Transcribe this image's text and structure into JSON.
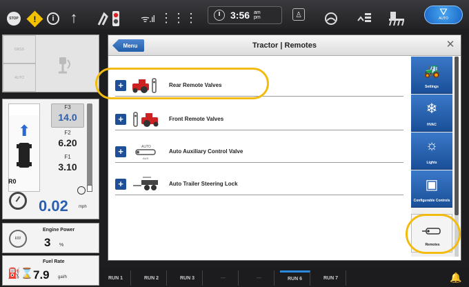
{
  "topbar": {
    "stop_text": "STOP",
    "warn_glyph": "!",
    "info_glyph": "i",
    "up_glyph": "↑",
    "signal_glyph": "ᯤ.ıl",
    "grid_glyph": "⋮⋮⋮",
    "time": "3:56",
    "ampm": "am\npm",
    "person_glyph": "♙",
    "auto_nav_glyph": "⛛",
    "auto_label": "AUTO",
    "icons": [
      "stop-icon",
      "warning-icon",
      "info-icon",
      "up-arrow-icon",
      "hitch-error-icon",
      "signal-icon",
      "grid-icon",
      "clock-icon",
      "person-icon",
      "steering-icon",
      "lift-icon",
      "implement-icon",
      "auto-steer-icon"
    ]
  },
  "left": {
    "top_labels": [
      "GNSS",
      "AUTO"
    ],
    "gears": [
      {
        "name": "F3",
        "value": "14.0"
      },
      {
        "name": "F2",
        "value": "6.20"
      },
      {
        "name": "F1",
        "value": "3.10"
      }
    ],
    "range": "R0",
    "speed": "0.02",
    "speed_unit": "mph",
    "engine_power_label": "Engine Power",
    "engine_power_value": "3",
    "engine_power_unit": "%",
    "engine_icon_text": "kW",
    "fuel_rate_label": "Fuel Rate",
    "fuel_rate_value": "7.9",
    "fuel_rate_unit": "gal/h"
  },
  "dialog": {
    "menu_label": "Menu",
    "title": "Tractor | Remotes",
    "close_glyph": "✕",
    "rows": [
      {
        "label": "Rear Remote Valves",
        "icon": "rear-remote-icon"
      },
      {
        "label": "Front Remote Valves",
        "icon": "front-remote-icon"
      },
      {
        "label": "Auto Auxiliary Control Valve",
        "icon": "auto-aux-valve-icon",
        "icon_text_top": "AUTO",
        "icon_text_bottom": "AUX"
      },
      {
        "label": "Auto Trailer Steering Lock",
        "icon": "trailer-steering-icon"
      }
    ]
  },
  "sidebar": {
    "buttons": [
      {
        "label": "Settings",
        "icon": "tractor-settings-icon"
      },
      {
        "label": "HVAC",
        "icon": "hvac-icon"
      },
      {
        "label": "Lights",
        "icon": "lights-icon"
      },
      {
        "label": "Configurable Controls",
        "icon": "configurable-controls-icon"
      },
      {
        "label": "Remotes",
        "icon": "remotes-icon"
      }
    ]
  },
  "runbar": {
    "slots": [
      "RUN 1",
      "RUN 2",
      "RUN 3",
      "—",
      "—",
      "RUN 6",
      "RUN 7"
    ],
    "bell_glyph": "🔔"
  },
  "colors": {
    "accent": "#2a6bd1",
    "header_blue": "#1a4f98",
    "highlight": "#f2bb10"
  }
}
